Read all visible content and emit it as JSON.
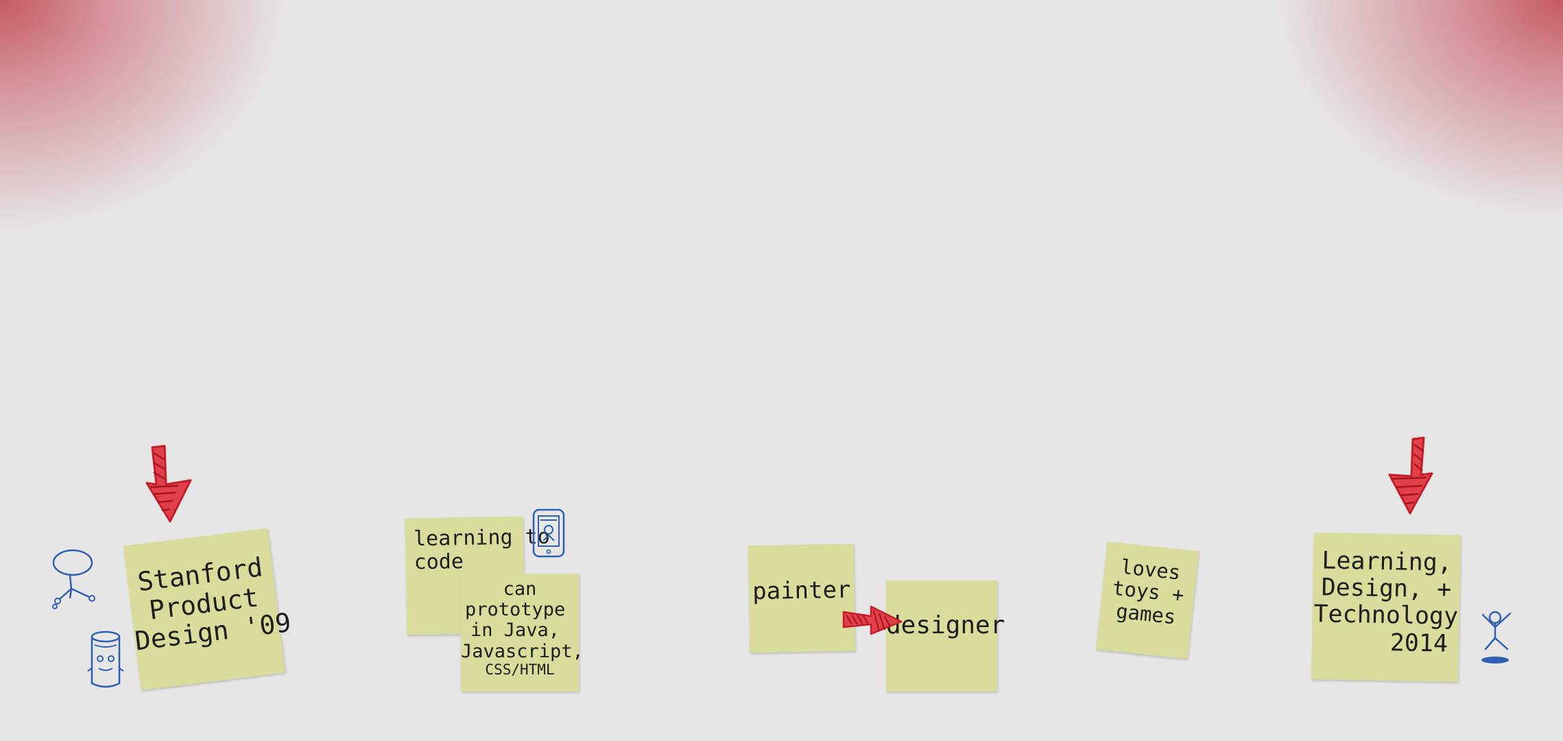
{
  "notes": {
    "stanford": {
      "lines": [
        "Stanford",
        "Product",
        "Design '09"
      ]
    },
    "learning_code": {
      "lines": [
        "learning to",
        "code"
      ]
    },
    "prototype": {
      "lines": [
        "can",
        "prototype",
        "in Java,",
        "Javascript,",
        "CSS/HTML"
      ]
    },
    "painter": {
      "lines": [
        "painter"
      ]
    },
    "designer": {
      "lines": [
        "designer"
      ]
    },
    "toys": {
      "lines": [
        "loves",
        "toys +",
        "games"
      ]
    },
    "ldt": {
      "lines": [
        "Learning,",
        "Design, +",
        "Technology",
        "2014"
      ]
    }
  },
  "icons": {
    "arrow_1": "red-arrow-icon",
    "arrow_2": "red-arrow-icon",
    "arrow_3": "red-arrow-icon",
    "stool": "stool-icon",
    "robot": "robot-icon",
    "phone": "phone-icon",
    "figure": "jumping-figure-icon"
  },
  "colors": {
    "note": "#d9dc9b",
    "arrow": "#d8262f",
    "ink_blue": "#2f5fb3",
    "corner_glow": "#c4525c"
  }
}
